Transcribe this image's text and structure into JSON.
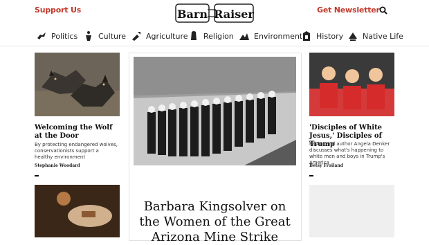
{
  "header": {
    "support": "Support Us",
    "logo": "Barn Raiser",
    "newsletter": "Get Newsletter",
    "search_icon": "search-icon"
  },
  "nav": {
    "items": [
      {
        "label": "Politics",
        "icon": "politics-icon"
      },
      {
        "label": "Culture",
        "icon": "culture-icon"
      },
      {
        "label": "Agriculture",
        "icon": "agriculture-icon"
      },
      {
        "label": "Religion",
        "icon": "religion-icon"
      },
      {
        "label": "Environment",
        "icon": "environment-icon"
      },
      {
        "label": "History",
        "icon": "history-icon"
      },
      {
        "label": "Native Life",
        "icon": "native-life-icon"
      }
    ]
  },
  "left_story": {
    "title": "Welcoming the Wolf at the Door",
    "desc": "By protecting endangered wolves, conservationists support a healthy environment",
    "author": "Stephanie Woodard"
  },
  "center_story": {
    "title": "Barbara Kingsolver on the Women of the Great Arizona Mine Strike"
  },
  "right_story": {
    "title": "'Disciples of White Jesus,' Disciples of Trump",
    "desc": "Pastor and author Angela Denker discusses what's happening to white men and boys in Trump's America",
    "author": "Betsy Froiland"
  },
  "colors": {
    "accent": "#c0392b"
  }
}
